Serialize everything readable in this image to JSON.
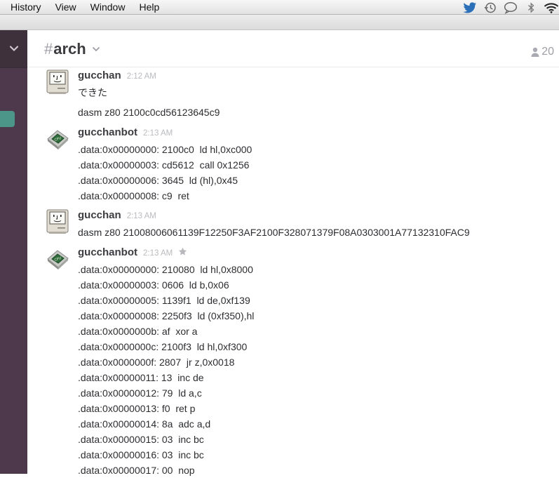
{
  "menubar": {
    "items": [
      "History",
      "View",
      "Window",
      "Help"
    ],
    "icons": [
      "twitter-icon",
      "time-machine-icon",
      "messages-icon",
      "bluetooth-icon",
      "wifi-icon"
    ]
  },
  "colors": {
    "sidebar": "#4d394b",
    "team_header": "#3e313c",
    "highlight": "#4c9689",
    "twitter": "#2a6fb8"
  },
  "channel": {
    "hash": "#",
    "name": "arch",
    "member_count": "20"
  },
  "messages": [
    {
      "user": "gucchan",
      "time": "2:12 AM",
      "avatar": "mac-avatar-icon",
      "lines": [
        "できた",
        "dasm z80 2100c0cd56123645c9"
      ]
    },
    {
      "user": "gucchanbot",
      "time": "2:13 AM",
      "avatar": "cpu-chip-avatar-icon",
      "lines": [
        ".data:0x00000000: 2100c0  ld hl,0xc000",
        ".data:0x00000003: cd5612  call 0x1256",
        ".data:0x00000006: 3645  ld (hl),0x45",
        ".data:0x00000008: c9  ret"
      ]
    },
    {
      "user": "gucchan",
      "time": "2:13 AM",
      "avatar": "mac-avatar-icon",
      "lines": [
        "dasm z80 21008006061139F12250F3AF2100F328071379F08A0303001A77132310FAC9"
      ]
    },
    {
      "user": "gucchanbot",
      "time": "2:13 AM",
      "avatar": "cpu-chip-avatar-icon",
      "starred": true,
      "lines": [
        ".data:0x00000000: 210080  ld hl,0x8000",
        ".data:0x00000003: 0606  ld b,0x06",
        ".data:0x00000005: 1139f1  ld de,0xf139",
        ".data:0x00000008: 2250f3  ld (0xf350),hl",
        ".data:0x0000000b: af  xor a",
        ".data:0x0000000c: 2100f3  ld hl,0xf300",
        ".data:0x0000000f: 2807  jr z,0x0018",
        ".data:0x00000011: 13  inc de",
        ".data:0x00000012: 79  ld a,c",
        ".data:0x00000013: f0  ret p",
        ".data:0x00000014: 8a  adc a,d",
        ".data:0x00000015: 03  inc bc",
        ".data:0x00000016: 03  inc bc",
        ".data:0x00000017: 00  nop"
      ]
    }
  ]
}
